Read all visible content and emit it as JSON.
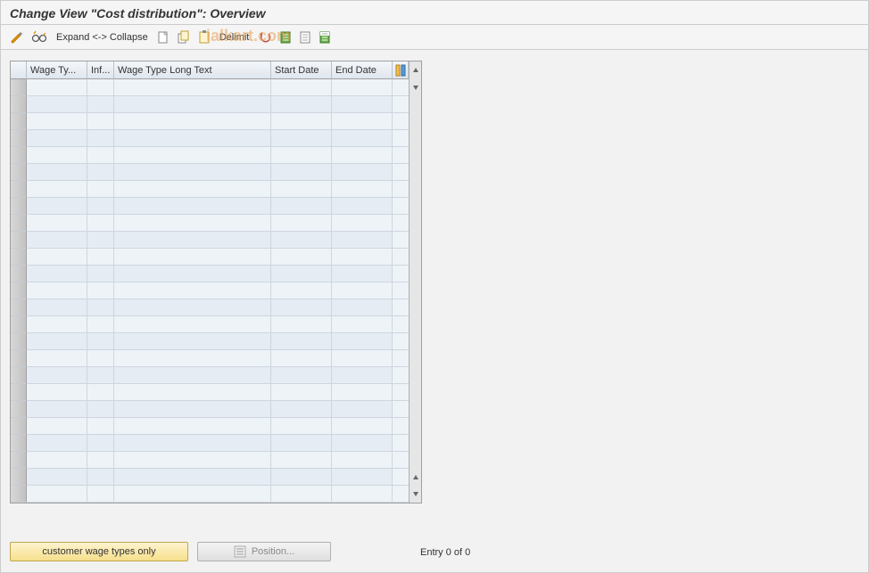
{
  "title": "Change View \"Cost distribution\": Overview",
  "toolbar": {
    "expand_collapse_label": "Expand <-> Collapse",
    "delimit_label": "Delimit"
  },
  "watermark_text": "ialkart.com",
  "table": {
    "columns": {
      "wage_type_short": "Wage Ty...",
      "inf": "Inf...",
      "wage_type_long": "Wage Type Long Text",
      "start_date": "Start Date",
      "end_date": "End Date"
    },
    "rows": [],
    "visible_row_count": 25
  },
  "footer": {
    "customer_wage_types_btn": "customer wage types only",
    "position_btn": "Position...",
    "entry_status": "Entry 0 of 0"
  }
}
